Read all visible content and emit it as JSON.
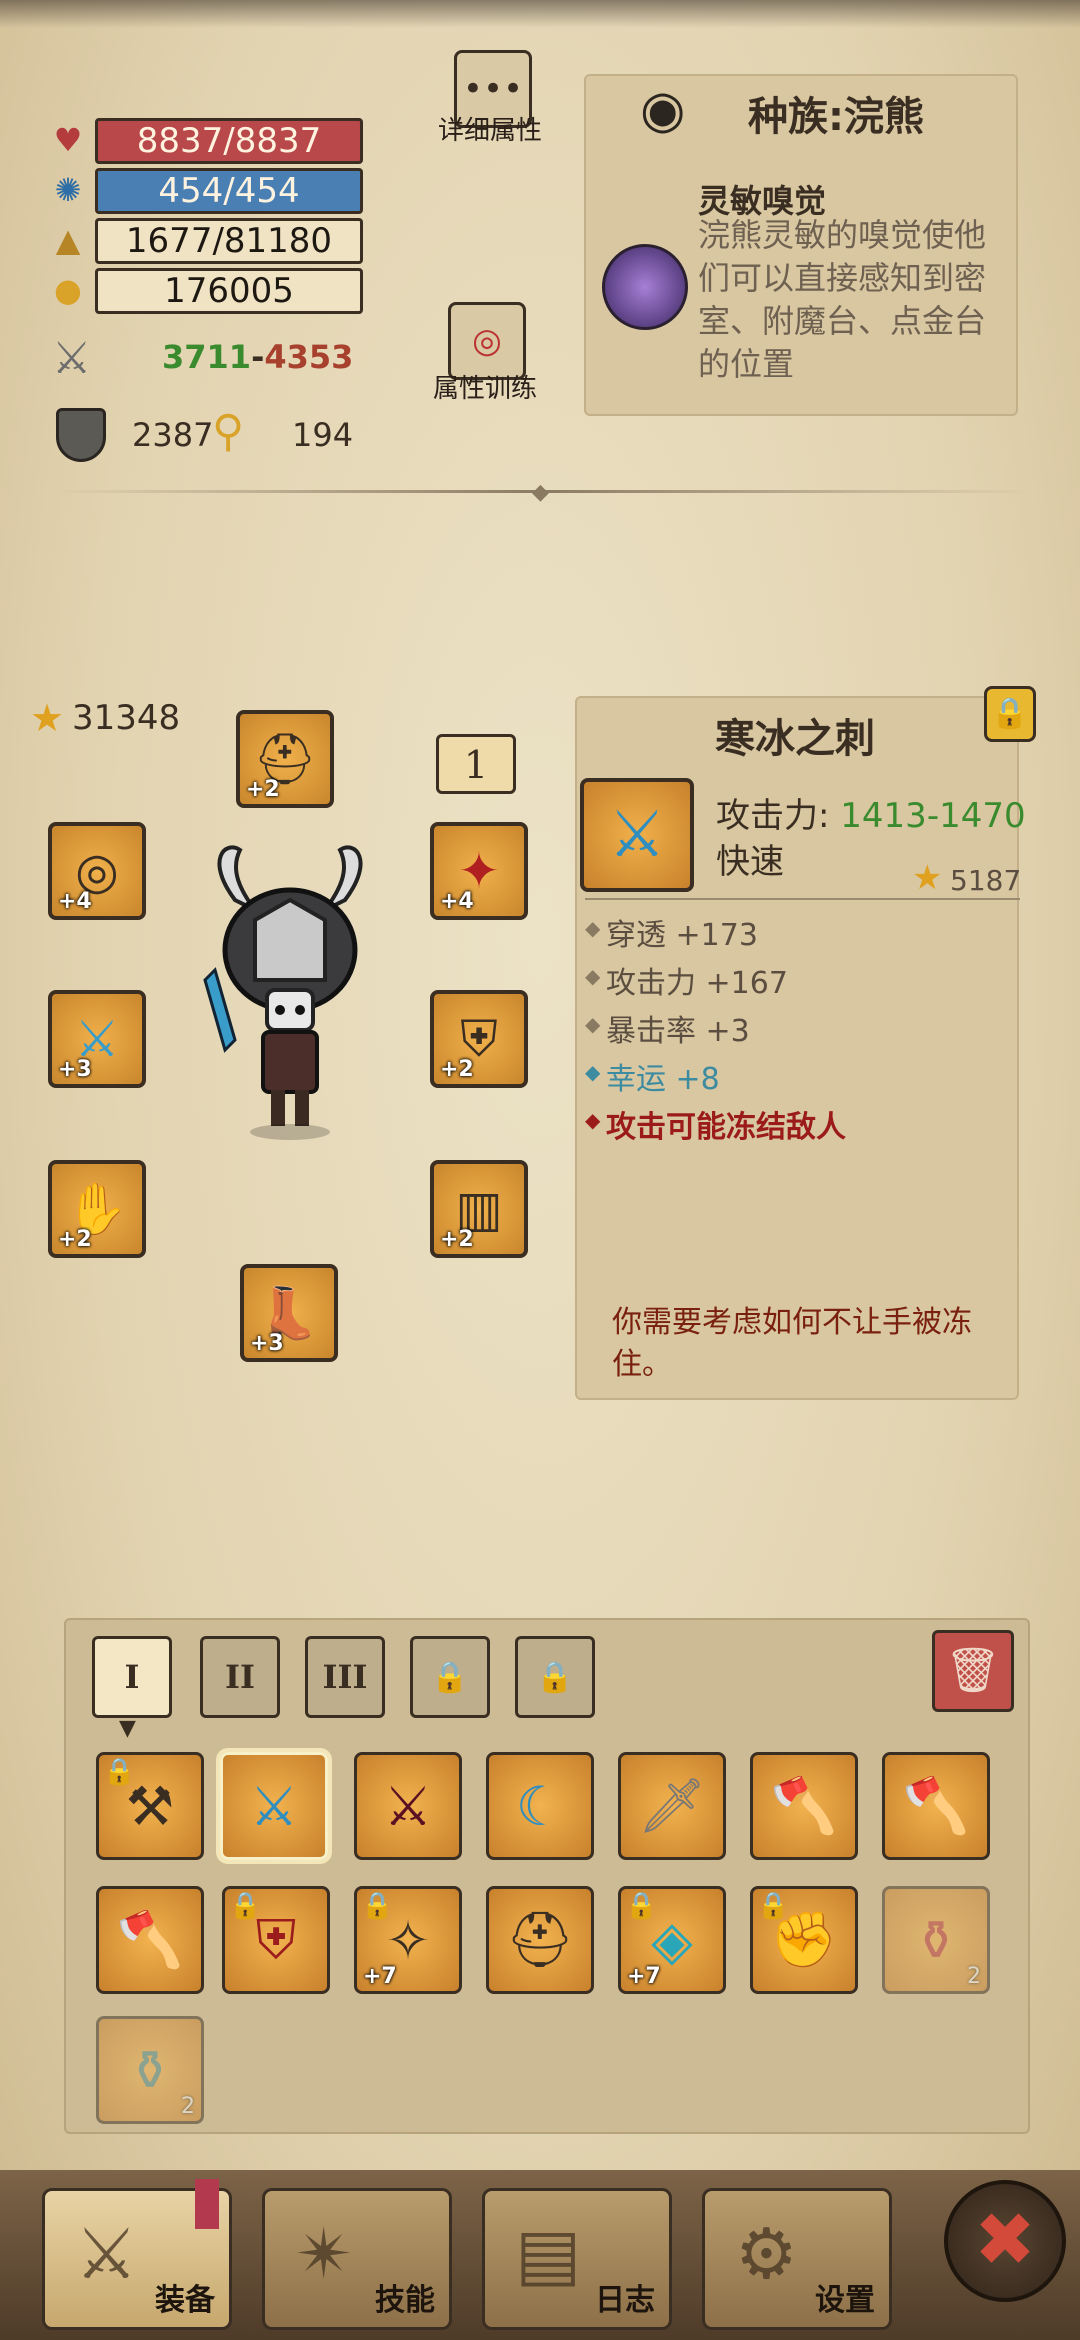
{
  "stats": {
    "hp": "8837/8837",
    "mp": "454/454",
    "xp": "1677/81180",
    "gold": "176005",
    "damage_min": "3711",
    "damage_sep": "-",
    "damage_max": "4353",
    "armor": "2387",
    "key_count": "194"
  },
  "buttons": {
    "details_label": "详细属性",
    "training_label": "属性训练"
  },
  "race": {
    "title": "种族:浣熊",
    "ability_name": "灵敏嗅觉",
    "ability_desc": "浣熊灵敏的嗅觉使他们可以直接感知到密室、附魔台、点金台的位置"
  },
  "equipment": {
    "star_score": "31348",
    "loadout_number": "1",
    "slots": [
      {
        "name": "helmet",
        "level": "+2"
      },
      {
        "name": "ring",
        "level": "+4"
      },
      {
        "name": "weapon",
        "level": "+3"
      },
      {
        "name": "gloves",
        "level": "+2"
      },
      {
        "name": "boots",
        "level": "+3"
      },
      {
        "name": "amulet",
        "level": "+4"
      },
      {
        "name": "armor",
        "level": "+2"
      },
      {
        "name": "pants",
        "level": "+2"
      }
    ]
  },
  "item": {
    "name": "寒冰之刺",
    "attack_label": "攻击力:",
    "attack_min": "1413",
    "attack_sep": "-",
    "attack_max": "1470",
    "speed": "快速",
    "stars": "5187",
    "bonuses": [
      "穿透 +173",
      "攻击力 +167",
      "暴击率 +3"
    ],
    "luck": "幸运 +8",
    "special": "攻击可能冻结敌人",
    "flavor": "你需要考虑如何不让手被冻住。"
  },
  "inventory": {
    "tabs": [
      "I",
      "II",
      "III"
    ],
    "items": [
      {
        "icon": "mace",
        "locked": true,
        "level": "",
        "count": ""
      },
      {
        "icon": "ice-blade",
        "locked": false,
        "level": "",
        "count": ""
      },
      {
        "icon": "dark-sword",
        "locked": false,
        "level": "",
        "count": ""
      },
      {
        "icon": "scimitar",
        "locked": false,
        "level": "",
        "count": ""
      },
      {
        "icon": "broadsword",
        "locked": false,
        "level": "",
        "count": ""
      },
      {
        "icon": "axe",
        "locked": false,
        "level": "",
        "count": ""
      },
      {
        "icon": "axe",
        "locked": false,
        "level": "",
        "count": ""
      },
      {
        "icon": "axe",
        "locked": false,
        "level": "",
        "count": ""
      },
      {
        "icon": "chest-armor",
        "locked": true,
        "level": "",
        "count": ""
      },
      {
        "icon": "feather-amulet",
        "locked": true,
        "level": "+7",
        "count": ""
      },
      {
        "icon": "helmet",
        "locked": false,
        "level": "",
        "count": ""
      },
      {
        "icon": "gem-ring",
        "locked": true,
        "level": "+7",
        "count": ""
      },
      {
        "icon": "gauntlet",
        "locked": true,
        "level": "",
        "count": ""
      },
      {
        "icon": "health-potion",
        "locked": false,
        "level": "",
        "count": "2",
        "faded": true
      },
      {
        "icon": "mana-potion",
        "locked": false,
        "level": "",
        "count": "2",
        "faded": true
      }
    ]
  },
  "nav": {
    "equip": "装备",
    "skills": "技能",
    "log": "日志",
    "settings": "设置"
  },
  "colors": {
    "hp": "#b8484a",
    "mp": "#4a7fb3",
    "damage_min": "#3a8a2e",
    "damage_max": "#a8402e",
    "luck": "#3d8ba0",
    "special": "#9b1b1b",
    "flavor": "#7a2010"
  }
}
